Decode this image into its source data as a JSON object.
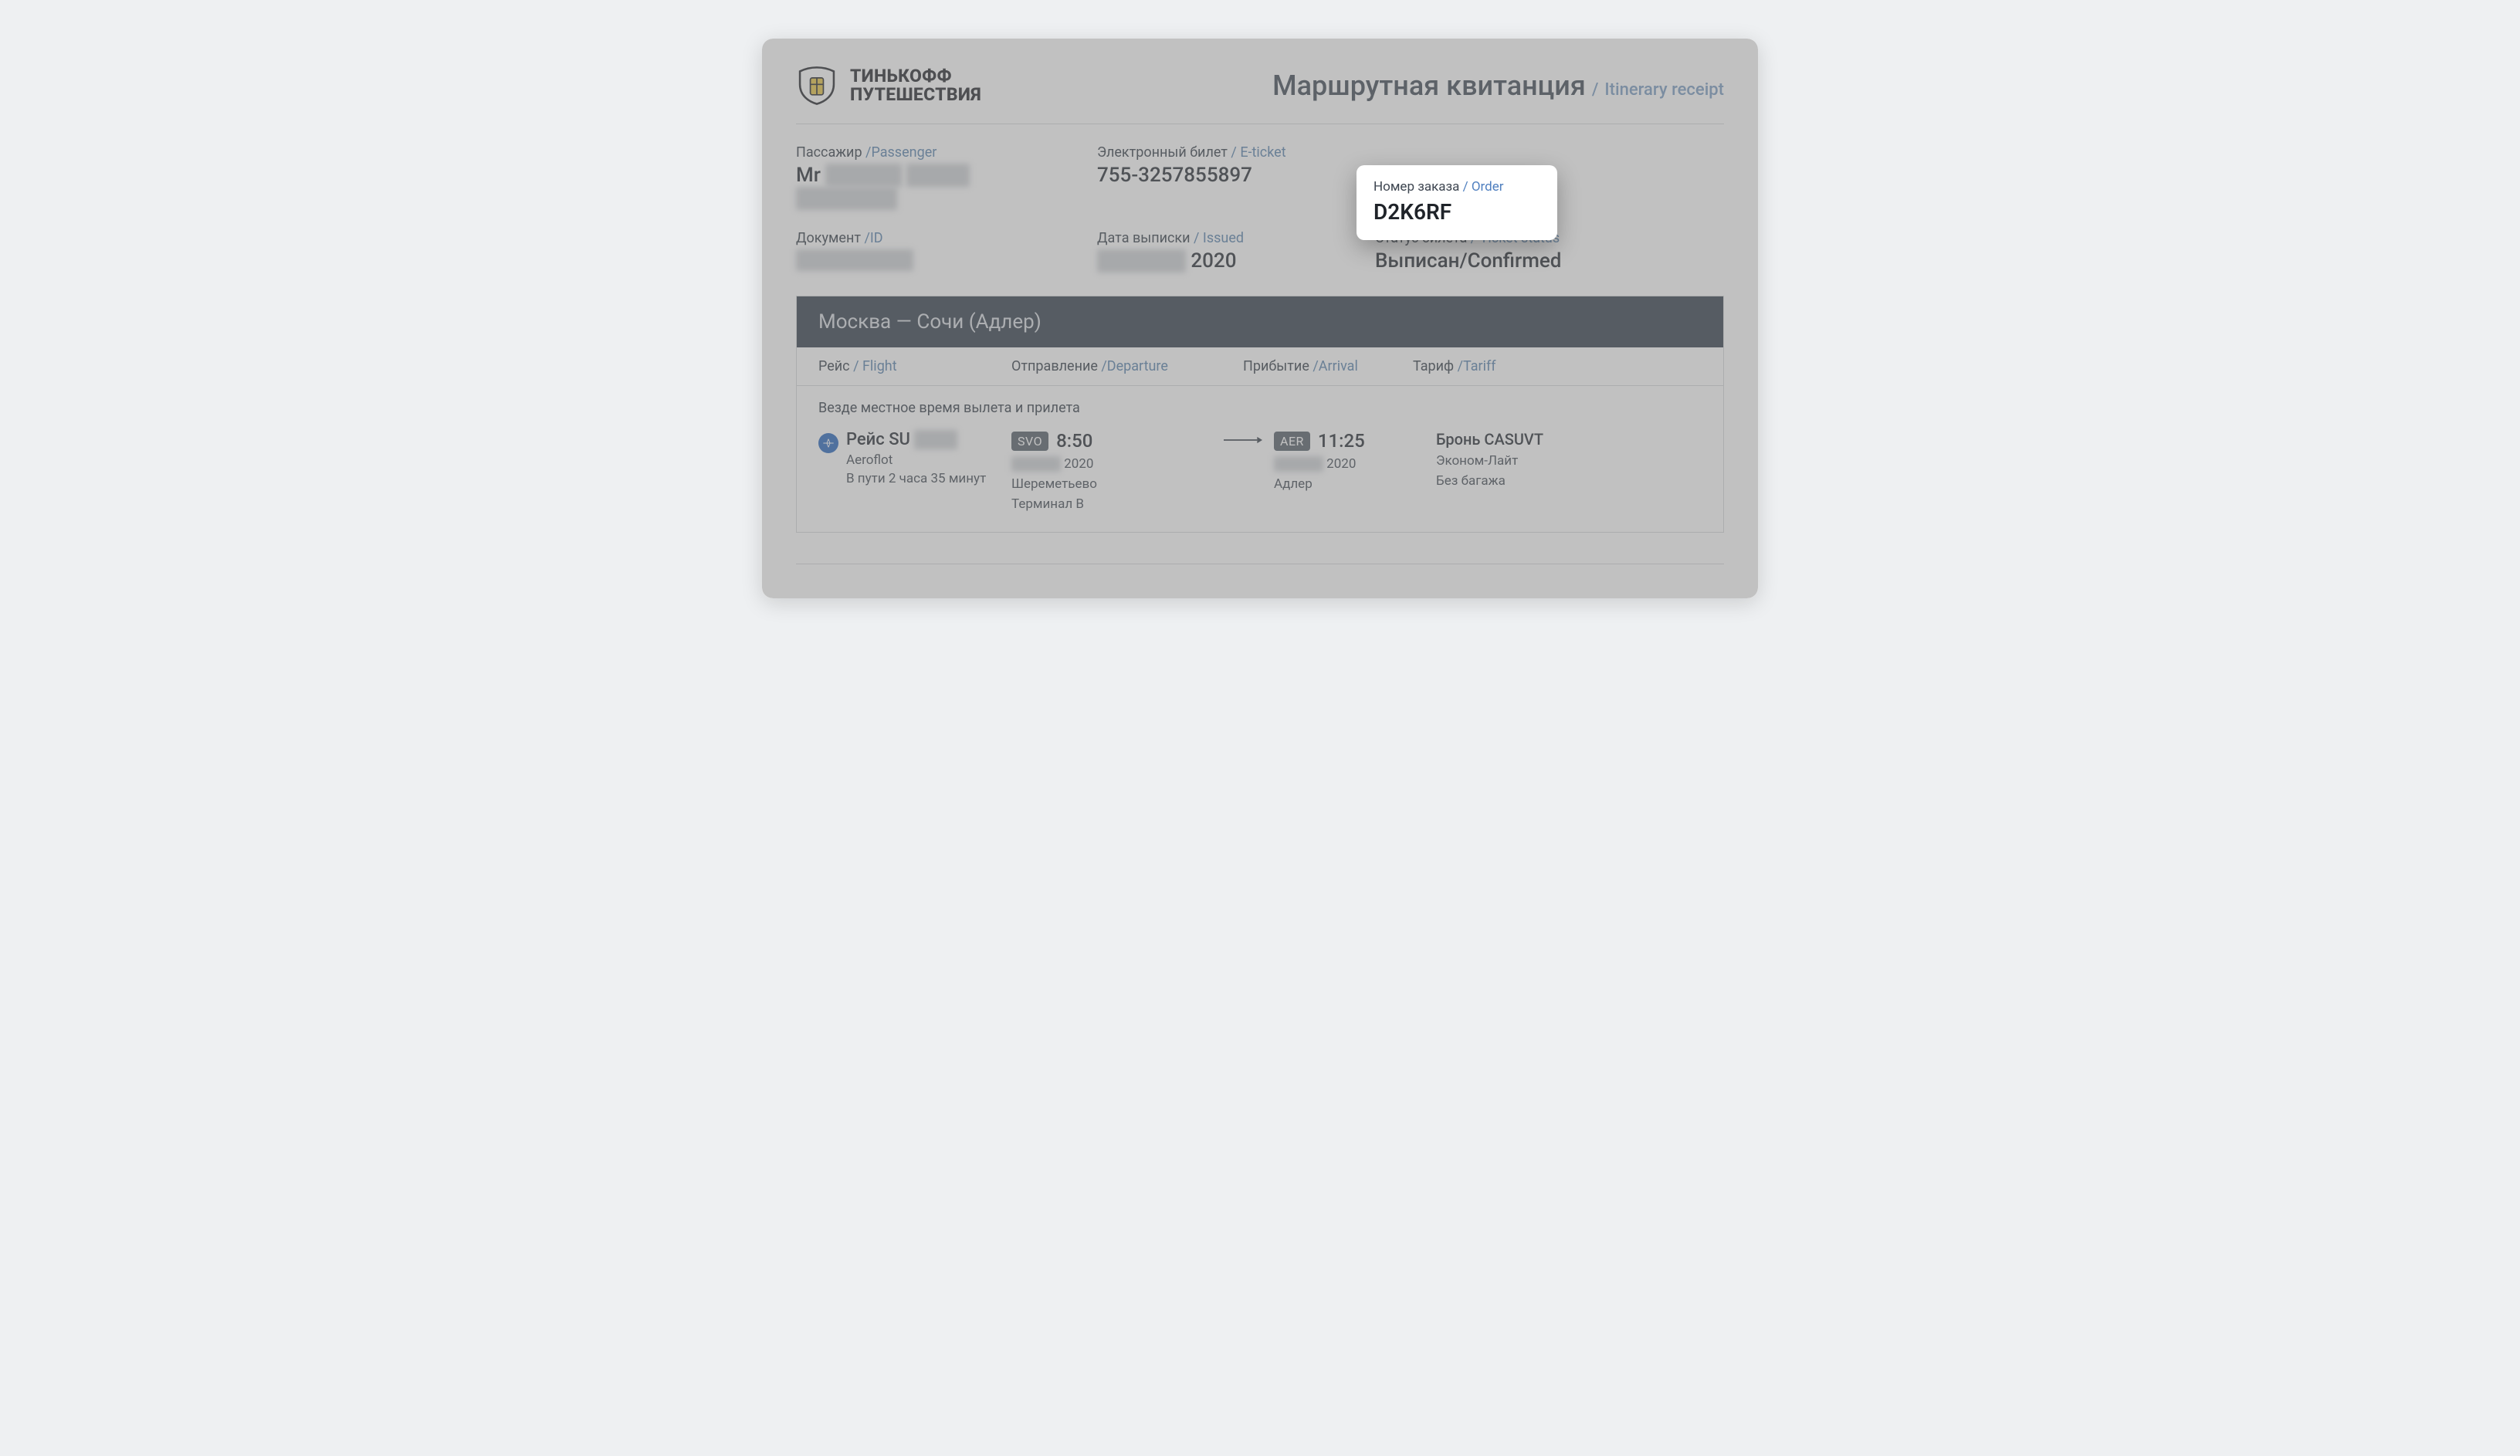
{
  "brand": {
    "line1": "ТИНЬКОФФ",
    "line2": "ПУТЕШЕСТВИЯ"
  },
  "doc_title": {
    "ru": "Маршрутная квитанция",
    "en": "Itinerary receipt"
  },
  "sep": "/",
  "fields": {
    "passenger": {
      "label_ru": "Пассажир",
      "label_en": "Passenger",
      "salutation": "Mr"
    },
    "eticket": {
      "label_ru": "Электронный билет",
      "label_en": "E-ticket",
      "value": "755-3257855897"
    },
    "order": {
      "label_ru": "Номер заказа",
      "label_en": "Order",
      "value": "D2K6RF"
    },
    "document": {
      "label_ru": "Документ",
      "label_en": "ID"
    },
    "issued": {
      "label_ru": "Дата выписки",
      "label_en": "Issued",
      "year": "2020"
    },
    "status": {
      "label_ru": "Статус билета",
      "label_en": "Ticket status",
      "value": "Выписан/Confirmed"
    }
  },
  "route_title": "Москва — Сочи (Адлер)",
  "columns": {
    "flight": {
      "ru": "Рейс",
      "en": "Flight"
    },
    "departure": {
      "ru": "Отправление",
      "en": "Departure"
    },
    "arrival": {
      "ru": "Прибытие",
      "en": "Arrival"
    },
    "tariff": {
      "ru": "Тариф",
      "en": "Tariff"
    }
  },
  "tz_note": "Везде местное время вылета и прилета",
  "flight": {
    "name_prefix": "Рейс SU",
    "airline": "Aeroflot",
    "duration": "В пути 2 часа 35 минут",
    "dep": {
      "code": "SVO",
      "time": "8:50",
      "year": "2020",
      "airport": "Шереметьево",
      "terminal": "Терминал B"
    },
    "arr": {
      "code": "AER",
      "time": "11:25",
      "year": "2020",
      "airport": "Адлер"
    },
    "tariff": {
      "booking": "Бронь CASUVT",
      "class": "Эконом-Лайт",
      "baggage": "Без багажа"
    }
  }
}
